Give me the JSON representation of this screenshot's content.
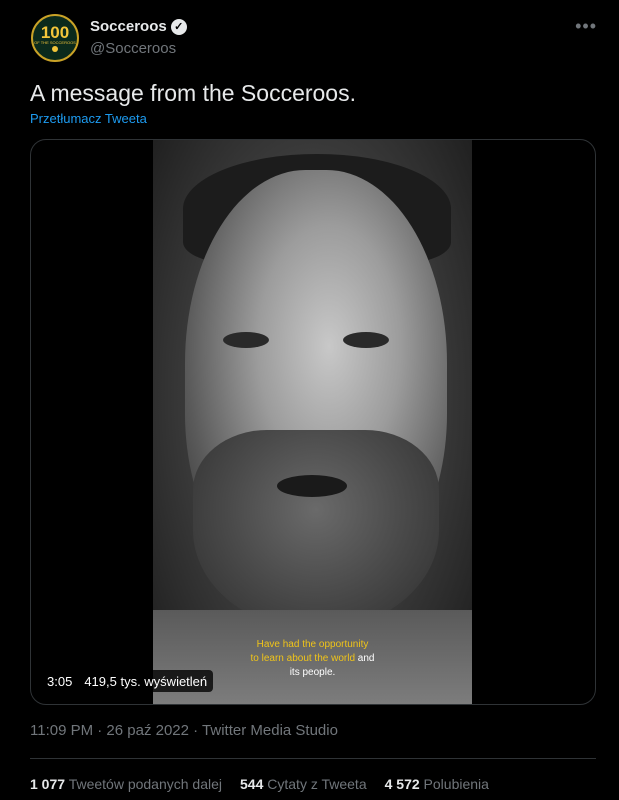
{
  "author": {
    "avatar_number": "100",
    "avatar_caption": "OF THE SOCCEROOS",
    "display_name": "Socceroos",
    "handle": "@Socceroos",
    "verified_icon": "verified-badge-icon"
  },
  "more_icon": "more-icon",
  "tweet": {
    "text": "A message from the Socceroos.",
    "translate_label": "Przetłumacz Tweeta"
  },
  "video": {
    "subtitle_line1": "Have had the opportunity",
    "subtitle_line2_a": "to learn about the world",
    "subtitle_line2_b": " and",
    "subtitle_line3": "its people.",
    "duration": "3:05",
    "views": "419,5 tys. wyświetleń"
  },
  "meta": {
    "time": "11:09 PM · 26 paź 2022 · Twitter Media Studio"
  },
  "stats": {
    "retweets_count": "1 077",
    "retweets_label": "Tweetów podanych dalej",
    "quotes_count": "544",
    "quotes_label": "Cytaty z Tweeta",
    "likes_count": "4 572",
    "likes_label": "Polubienia"
  },
  "colors": {
    "background": "#000000",
    "link": "#1d9bf0",
    "subtitle_accent": "#f0c419"
  }
}
